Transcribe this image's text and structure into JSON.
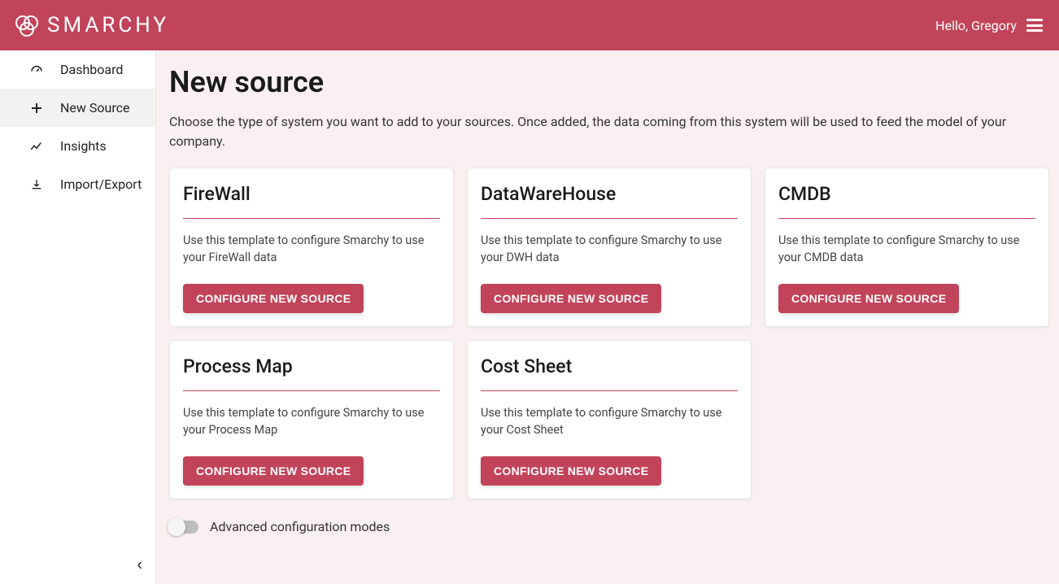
{
  "header": {
    "brand": "SMARCHY",
    "greeting": "Hello, Gregory"
  },
  "sidebar": {
    "items": [
      {
        "label": "Dashboard",
        "icon": "gauge-icon",
        "active": false
      },
      {
        "label": "New Source",
        "icon": "plus-icon",
        "active": true
      },
      {
        "label": "Insights",
        "icon": "chart-line-icon",
        "active": false
      },
      {
        "label": "Import/Export",
        "icon": "download-icon",
        "active": false
      }
    ]
  },
  "main": {
    "title": "New source",
    "description": "Choose the type of system you want to add to your sources. Once added, the data coming from this system will be used to feed the model of your company.",
    "cards": [
      {
        "title": "FireWall",
        "desc": "Use this template to configure Smarchy to use your FireWall data",
        "button": "CONFIGURE NEW SOURCE"
      },
      {
        "title": "DataWareHouse",
        "desc": "Use this template to configure Smarchy to use your DWH data",
        "button": "CONFIGURE NEW SOURCE"
      },
      {
        "title": "CMDB",
        "desc": "Use this template to configure Smarchy to use your CMDB data",
        "button": "CONFIGURE NEW SOURCE"
      },
      {
        "title": "Process Map",
        "desc": "Use this template to configure Smarchy to use your Process Map",
        "button": "CONFIGURE NEW SOURCE"
      },
      {
        "title": "Cost Sheet",
        "desc": "Use this template to configure Smarchy to use your Cost Sheet",
        "button": "CONFIGURE NEW SOURCE"
      }
    ],
    "toggle_label": "Advanced configuration modes",
    "toggle_on": false
  }
}
